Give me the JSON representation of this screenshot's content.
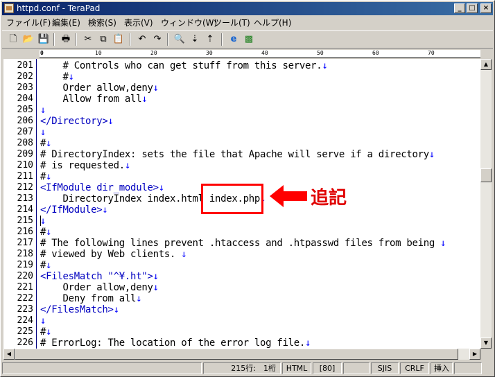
{
  "title": "httpd.conf - TeraPad",
  "menu": [
    "ファイル(F)",
    "編集(E)",
    "検索(S)",
    "表示(V)",
    "ウィンドウ(W)",
    "ツール(T)",
    "ヘルプ(H)"
  ],
  "toolbar_icons": [
    "new-file-icon",
    "open-folder-icon",
    "save-icon",
    "print-icon",
    "cut-icon",
    "copy-icon",
    "paste-icon",
    "undo-icon",
    "redo-icon",
    "find-icon",
    "find-next-icon",
    "find-prev-icon",
    "browser-icon",
    "tool-icon"
  ],
  "ruler": {
    "marks": [
      "0",
      "10",
      "20",
      "30",
      "40",
      "50",
      "60",
      "70"
    ]
  },
  "editor": {
    "line_numbers": [
      "201",
      "202",
      "203",
      "204",
      "205",
      "206",
      "207",
      "208",
      "209",
      "210",
      "211",
      "212",
      "213",
      "214",
      "215",
      "216",
      "217",
      "218",
      "219",
      "220",
      "221",
      "222",
      "223",
      "224",
      "225",
      "226"
    ],
    "lines": [
      {
        "text": "    # Controls who can get stuff from this server.",
        "eol": "↓",
        "kind": "text"
      },
      {
        "text": "    #",
        "eol": "↓",
        "kind": "text"
      },
      {
        "text": "    Order allow,deny",
        "eol": "↓",
        "kind": "text"
      },
      {
        "text": "    Allow from all",
        "eol": "↓",
        "kind": "text"
      },
      {
        "text": "",
        "eol": "↓",
        "kind": "text"
      },
      {
        "text": "</Directory>",
        "eol": "↓",
        "kind": "tag"
      },
      {
        "text": "",
        "eol": "↓",
        "kind": "text"
      },
      {
        "text": "#",
        "eol": "↓",
        "kind": "text"
      },
      {
        "text": "# DirectoryIndex: sets the file that Apache will serve if a directory",
        "eol": "↓",
        "kind": "text"
      },
      {
        "text": "# is requested.",
        "eol": "↓",
        "kind": "text"
      },
      {
        "text": "#",
        "eol": "↓",
        "kind": "text"
      },
      {
        "text": "<IfModule dir_module>",
        "eol": "↓",
        "kind": "tag"
      },
      {
        "text": "    DirectoryIndex index.html index.php",
        "eol": "↓",
        "kind": "text"
      },
      {
        "text": "</IfModule>",
        "eol": "↓",
        "kind": "tag"
      },
      {
        "text": "",
        "eol": "↓",
        "kind": "text"
      },
      {
        "text": "#",
        "eol": "↓",
        "kind": "text"
      },
      {
        "text": "# The following lines prevent .htaccess and .htpasswd files from being ",
        "eol": "↓",
        "kind": "text"
      },
      {
        "text": "# viewed by Web clients. ",
        "eol": "↓",
        "kind": "text"
      },
      {
        "text": "#",
        "eol": "↓",
        "kind": "text"
      },
      {
        "text": "<FilesMatch \"^¥.ht\">",
        "eol": "↓",
        "kind": "tag"
      },
      {
        "text": "    Order allow,deny",
        "eol": "↓",
        "kind": "text"
      },
      {
        "text": "    Deny from all",
        "eol": "↓",
        "kind": "text"
      },
      {
        "text": "</FilesMatch>",
        "eol": "↓",
        "kind": "tag"
      },
      {
        "text": "",
        "eol": "↓",
        "kind": "text"
      },
      {
        "text": "#",
        "eol": "↓",
        "kind": "text"
      },
      {
        "text": "# ErrorLog: The location of the error log file.",
        "eol": "↓",
        "kind": "text"
      }
    ]
  },
  "annotation": {
    "label": "追記",
    "color": "#ff0000"
  },
  "status": {
    "position": "215行:　1桁",
    "mode": "HTML",
    "width": "[80]",
    "encoding": "SJIS",
    "newline": "CRLF",
    "insert": "挿入"
  }
}
